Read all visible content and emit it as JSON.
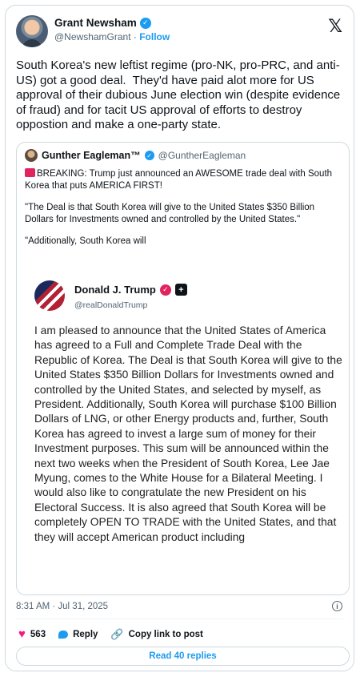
{
  "author": {
    "name": "Grant Newsham",
    "handle": "@NewshamGrant",
    "separator": " · ",
    "follow_label": "Follow"
  },
  "tweet": {
    "text": "South Korea's new leftist regime (pro-NK, pro-PRC, and anti-US) got a good deal.  They'd have paid alot more for US approval of their dubious June election win (despite evidence of fraud) and for tacit US approval of efforts to destroy oppostion and make a one-party state."
  },
  "quote": {
    "name": "Gunther Eagleman™",
    "handle": "@GuntherEagleman",
    "paragraphs": [
      "BREAKING: Trump just announced an AWESOME trade deal with South Korea that puts AMERICA FIRST!",
      "\"The Deal is that South Korea will give to the United States $350 Billion Dollars for Investments owned and controlled by the United States.\"",
      "\"Additionally, South Korea will"
    ],
    "embedded_post": {
      "name": "Donald J. Trump",
      "handle": "@realDonaldTrump",
      "body": "I am pleased to announce that the United States of America has agreed to a Full and Complete Trade Deal with the Republic of Korea. The Deal is that South Korea will give to the United States $350 Billion Dollars for Investments owned and controlled by the United States, and selected by myself, as President. Additionally, South Korea will purchase $100 Billion Dollars of LNG, or other Energy products and, further, South Korea has agreed to invest a large sum of money for their Investment purposes. This sum will be announced within the next two weeks when the President of South Korea, Lee Jae Myung, comes to the White House for a Bilateral Meeting. I would also like to congratulate the new President on his Electoral Success. It is also agreed that South Korea will be completely OPEN TO TRADE with the United States, and that they will accept American product including"
    }
  },
  "meta": {
    "timestamp": "8:31 AM · Jul 31, 2025"
  },
  "actions": {
    "like_count": "563",
    "reply_label": "Reply",
    "copy_link_label": "Copy link to post",
    "read_replies_label": "Read 40 replies"
  },
  "colors": {
    "accent": "#1d9bf0",
    "like": "#f91880",
    "border": "#cfd9de",
    "muted": "#536471"
  },
  "icons": [
    "x-logo-icon",
    "verified-badge-icon",
    "siren-icon",
    "truth-verified-icon",
    "plus-icon",
    "info-icon",
    "heart-icon",
    "reply-icon",
    "link-icon"
  ]
}
